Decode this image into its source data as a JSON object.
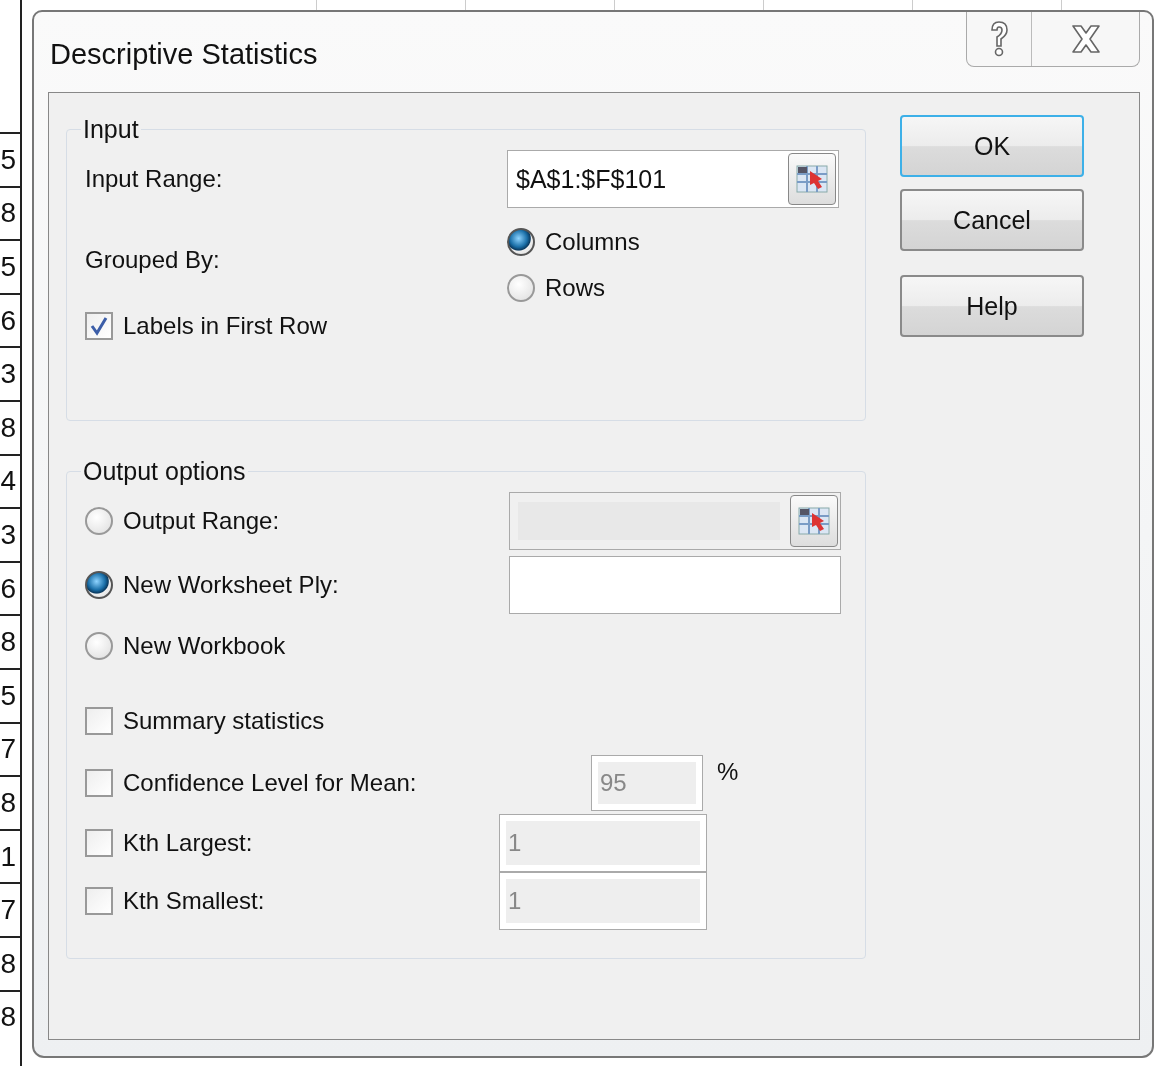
{
  "spreadsheet": {
    "row_values": [
      "5",
      "8",
      "5",
      "6",
      "3",
      "8",
      "4",
      "3",
      "6",
      "8",
      "5",
      "7",
      "8",
      "1",
      "7",
      "8",
      "8"
    ]
  },
  "dialog": {
    "title": "Descriptive Statistics",
    "input": {
      "legend": "Input",
      "input_range": {
        "label": "Input Range:",
        "value": "$A$1:$F$101"
      },
      "grouped_by": {
        "label": "Grouped By:",
        "options": [
          {
            "label": "Columns",
            "selected": true
          },
          {
            "label": "Rows",
            "selected": false
          }
        ]
      },
      "labels_in_first_row": {
        "label": "Labels in First Row",
        "checked": true
      }
    },
    "output": {
      "legend": "Output options",
      "destinations": [
        {
          "label": "Output Range:",
          "selected": false,
          "field": {
            "kind": "range",
            "disabled": true
          }
        },
        {
          "label": "New Worksheet Ply:",
          "selected": true,
          "field": {
            "kind": "text",
            "disabled": false
          }
        },
        {
          "label": "New Workbook",
          "selected": false
        }
      ],
      "statistics": [
        {
          "kind": "plain",
          "label": "Summary statistics",
          "checked": false
        },
        {
          "kind": "percent",
          "label": "Confidence Level for Mean:",
          "checked": false,
          "value": "95",
          "unit": "%",
          "disabled": true
        },
        {
          "kind": "number",
          "label": "Kth Largest:",
          "checked": false,
          "value": "1",
          "disabled": true
        },
        {
          "kind": "number",
          "label": "Kth Smallest:",
          "checked": false,
          "value": "1",
          "disabled": true
        }
      ]
    },
    "buttons": [
      {
        "label": "OK",
        "default": true
      },
      {
        "label": "Cancel",
        "default": false
      },
      {
        "label": "Help",
        "default": false
      }
    ]
  }
}
